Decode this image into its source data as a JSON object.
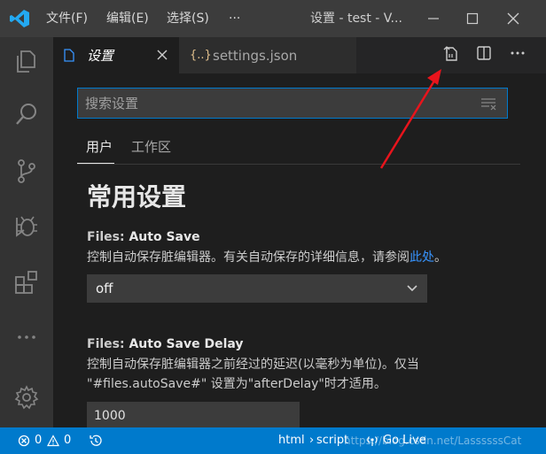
{
  "titlebar": {
    "menu": [
      "文件(F)",
      "编辑(E)",
      "选择(S)",
      "···"
    ],
    "title": "设置 - test - V...",
    "window_controls": [
      "minimize-icon",
      "maximize-icon",
      "close-icon"
    ]
  },
  "activitybar": {
    "items": [
      "explorer-icon",
      "search-icon",
      "source-control-icon",
      "debug-icon",
      "extensions-icon",
      "more-icon",
      "settings-gear-icon"
    ]
  },
  "tabs": {
    "active_label": "设置",
    "inactive_label": "settings.json",
    "inactive_icon": "{..}",
    "actions": [
      "open-settings-json-icon",
      "split-editor-icon",
      "more-actions-icon"
    ]
  },
  "settings": {
    "search_placeholder": "搜索设置",
    "scopes": [
      "用户",
      "工作区"
    ],
    "section_title": "常用设置",
    "auto_save": {
      "category": "Files: ",
      "name": "Auto Save",
      "desc": "控制自动保存脏编辑器。有关自动保存的详细信息，请参阅",
      "link": "此处",
      "desc_end": "。",
      "value": "off"
    },
    "auto_save_delay": {
      "category": "Files: ",
      "name": "Auto Save Delay",
      "desc_line1": "控制自动保存脏编辑器之前经过的延迟(以毫秒为单位)。仅当",
      "desc_line2": "\"#files.autoSave#\" 设置为\"afterDelay\"时才适用。",
      "value": "1000"
    }
  },
  "statusbar": {
    "errors": "0",
    "warnings": "0",
    "language": "html",
    "breadcrumb": "script",
    "go_live": "Go Live",
    "watermark": "https://blog.csdn.net/LassssssCat"
  },
  "colors": {
    "accent": "#007acc",
    "titlebar": "#3c3c3c",
    "activitybar": "#333333",
    "editor": "#1e1e1e",
    "annotation_arrow": "#e8141c"
  }
}
